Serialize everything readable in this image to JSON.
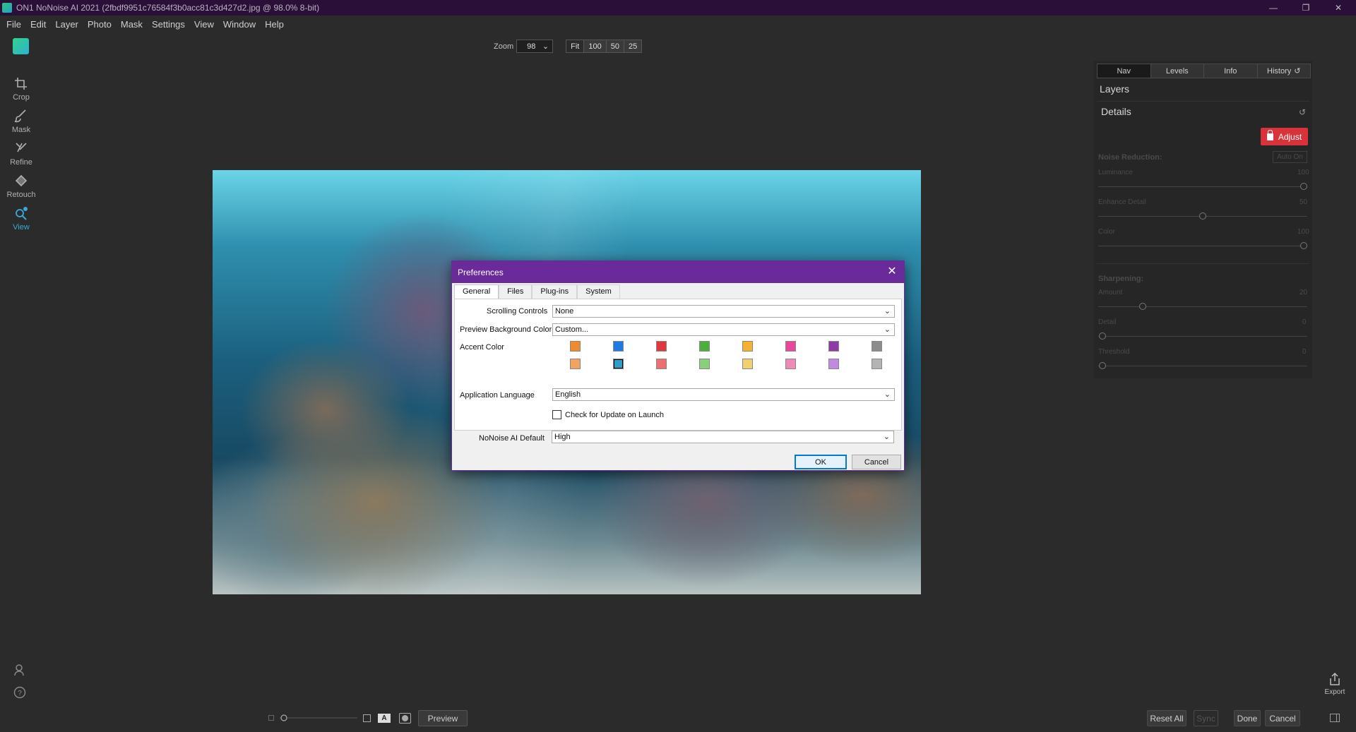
{
  "window": {
    "title": "ON1 NoNoise AI 2021 (2fbdf9951c76584f3b0acc81c3d427d2.jpg @ 98.0% 8-bit)",
    "minimize": "—",
    "restore": "❐",
    "close": "✕"
  },
  "menu": [
    "File",
    "Edit",
    "Layer",
    "Photo",
    "Mask",
    "Settings",
    "View",
    "Window",
    "Help"
  ],
  "tools": [
    {
      "label": "Crop",
      "icon": "crop-icon",
      "active": false
    },
    {
      "label": "Mask",
      "icon": "mask-brush-icon",
      "active": false
    },
    {
      "label": "Refine",
      "icon": "refine-brush-icon",
      "active": false
    },
    {
      "label": "Retouch",
      "icon": "retouch-icon",
      "active": false
    },
    {
      "label": "View",
      "icon": "zoom-view-icon",
      "active": true
    }
  ],
  "zoom": {
    "label": "Zoom",
    "value": "98",
    "presets": [
      "Fit",
      "100",
      "50",
      "25"
    ]
  },
  "right_panel": {
    "tabs": [
      "Nav",
      "Levels",
      "Info",
      "History"
    ],
    "active_tab": "Nav",
    "layers_title": "Layers",
    "details_title": "Details",
    "adjust_label": "Adjust",
    "noise_reduction": {
      "title": "Noise Reduction:",
      "auto_label": "Auto On",
      "luminance": {
        "label": "Luminance",
        "value": "100"
      },
      "enhance_detail": {
        "label": "Enhance Detail",
        "value": "50"
      },
      "color": {
        "label": "Color",
        "value": "100"
      }
    },
    "sharpening": {
      "title": "Sharpening:",
      "amount": {
        "label": "Amount",
        "value": "20"
      },
      "detail": {
        "label": "Detail",
        "value": "0"
      },
      "threshold": {
        "label": "Threshold",
        "value": "0"
      }
    }
  },
  "bottom": {
    "preview_label": "Preview",
    "reset_all": "Reset All",
    "sync": "Sync",
    "done": "Done",
    "cancel": "Cancel",
    "export": "Export",
    "a_label": "A"
  },
  "preferences": {
    "title": "Preferences",
    "tabs": [
      "General",
      "Files",
      "Plug-ins",
      "System"
    ],
    "active_tab": "General",
    "scrolling_controls": {
      "label": "Scrolling Controls",
      "value": "None"
    },
    "preview_bg": {
      "label": "Preview Background Color",
      "value": "Custom..."
    },
    "accent_color": {
      "label": "Accent Color",
      "row1": [
        "#f08a2e",
        "#1e7ae0",
        "#e0393b",
        "#4cae3b",
        "#f5b232",
        "#e8479a",
        "#8e3ba8",
        "#8c8c8c"
      ],
      "row2": [
        "#f0a460",
        "#2aa0c8",
        "#ec7070",
        "#8ad07a",
        "#f0d070",
        "#ee8ab8",
        "#c08ae0",
        "#b4b4b4"
      ],
      "selected": "#2aa0c8"
    },
    "language": {
      "label": "Application Language",
      "value": "English"
    },
    "check_update": {
      "label": "Check for Update on Launch",
      "checked": false
    },
    "nonoise_default": {
      "label": "NoNoise AI Default",
      "value": "High"
    },
    "ok": "OK",
    "cancel": "Cancel"
  },
  "colors": {
    "accent": "#3aa9d8",
    "dialog_title": "#6b2a9a",
    "adjust": "#d8323b"
  }
}
